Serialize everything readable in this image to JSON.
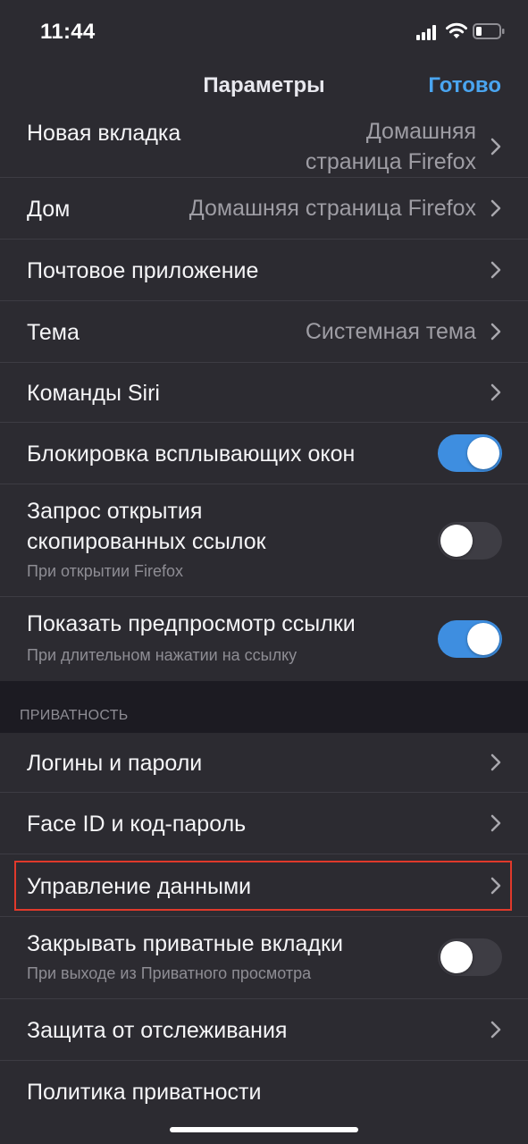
{
  "status_bar": {
    "time": "11:44",
    "icons": [
      "signal-icon",
      "wifi-icon",
      "battery-icon"
    ]
  },
  "nav": {
    "title": "Параметры",
    "done_label": "Готово"
  },
  "colors": {
    "accent": "#4aa5f0",
    "toggle_on": "#3e8ee0",
    "highlight": "#e0392b",
    "row_background": "#2c2b31",
    "page_background": "#1c1b22"
  },
  "general": {
    "new_tab": {
      "label": "Новая вкладка",
      "value_line1": "Домашняя",
      "value_line2": "страница Firefox"
    },
    "home": {
      "label": "Дом",
      "value": "Домашняя страница Firefox"
    },
    "mail_app": {
      "label": "Почтовое приложение"
    },
    "theme": {
      "label": "Тема",
      "value": "Системная тема"
    },
    "siri": {
      "label": "Команды Siri"
    },
    "block_popups": {
      "label": "Блокировка всплывающих окон",
      "enabled": true
    },
    "offer_clipboard": {
      "label_line1": "Запрос открытия",
      "label_line2": "скопированных ссылок",
      "sublabel": "При открытии Firefox",
      "enabled": false
    },
    "link_preview": {
      "label": "Показать предпросмотр ссылки",
      "sublabel": "При длительном нажатии на ссылку",
      "enabled": true
    }
  },
  "privacy": {
    "header": "ПРИВАТНОСТЬ",
    "logins": {
      "label": "Логины и пароли"
    },
    "face_id": {
      "label": "Face ID и код-пароль"
    },
    "data_management": {
      "label": "Управление данными",
      "highlighted": true
    },
    "close_private_tabs": {
      "label": "Закрывать приватные вкладки",
      "sublabel": "При выходе из Приватного просмотра",
      "enabled": false
    },
    "tracking_protection": {
      "label": "Защита от отслеживания"
    },
    "privacy_policy": {
      "label": "Политика приватности"
    }
  }
}
